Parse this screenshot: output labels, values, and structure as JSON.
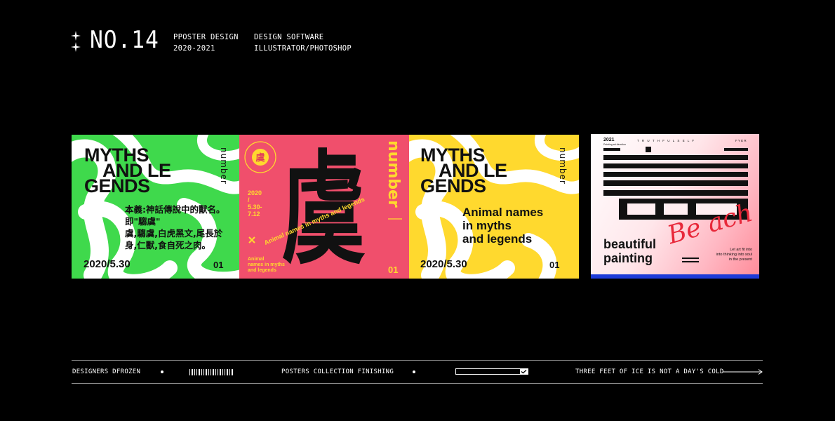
{
  "header": {
    "number": "NO.14",
    "project_line1": "PPOSTER DESIGN",
    "project_line2": "2020-2021",
    "software_line1": "DESIGN SOFTWARE",
    "software_line2": "ILLUSTRATOR/PHOTOSHOP"
  },
  "poster1": {
    "title": [
      "MYTHS",
      "AND LE",
      "GENDS"
    ],
    "vertical": "number",
    "cn_text": [
      "本義:神話傳說中的獸名。",
      "即\"騶虞\"",
      "虞,騶虞,白虎黑文,尾長於",
      "身,仁獸,食自死之肉。"
    ],
    "date": "2020/5.30",
    "num": "01"
  },
  "poster2": {
    "char": "虞",
    "seal_char": "虞",
    "seal_ring_text": "ANIMAL NAMES · MYTH",
    "vertical": "number",
    "date_lines": [
      "2020",
      "/",
      "5.30-",
      "7.12"
    ],
    "diagonal": "Animal names in myths and legends",
    "small": [
      "Animal",
      "names in myths",
      "and legends"
    ],
    "num": "01"
  },
  "poster3": {
    "title": [
      "MYTHS",
      "AND LE",
      "GENDS"
    ],
    "vertical": "number",
    "sub": [
      "Animal names",
      "in myths",
      "and legends"
    ],
    "date": "2020/5.30",
    "num": "01"
  },
  "poster4": {
    "year": "2021",
    "tiny": "Painting art direction",
    "spaced": "T R U T H F U L S E L F",
    "corner": "F Y E R",
    "script": "Be ach",
    "title": [
      "beautiful",
      "painting"
    ],
    "caption": [
      "Let art fit into",
      "into thinking into soul",
      "in the present"
    ]
  },
  "footer": {
    "designers": "DESIGNERS  DFROZEN",
    "middle": "POSTERS COLLECTION FINISHING",
    "slogan": "THREE FEET OF ICE IS NOT A DAY'S COLD"
  },
  "colors": {
    "green": "#3fd94c",
    "pink": "#f04f6c",
    "yellow": "#ffd92e",
    "blue": "#1d3bd8"
  }
}
